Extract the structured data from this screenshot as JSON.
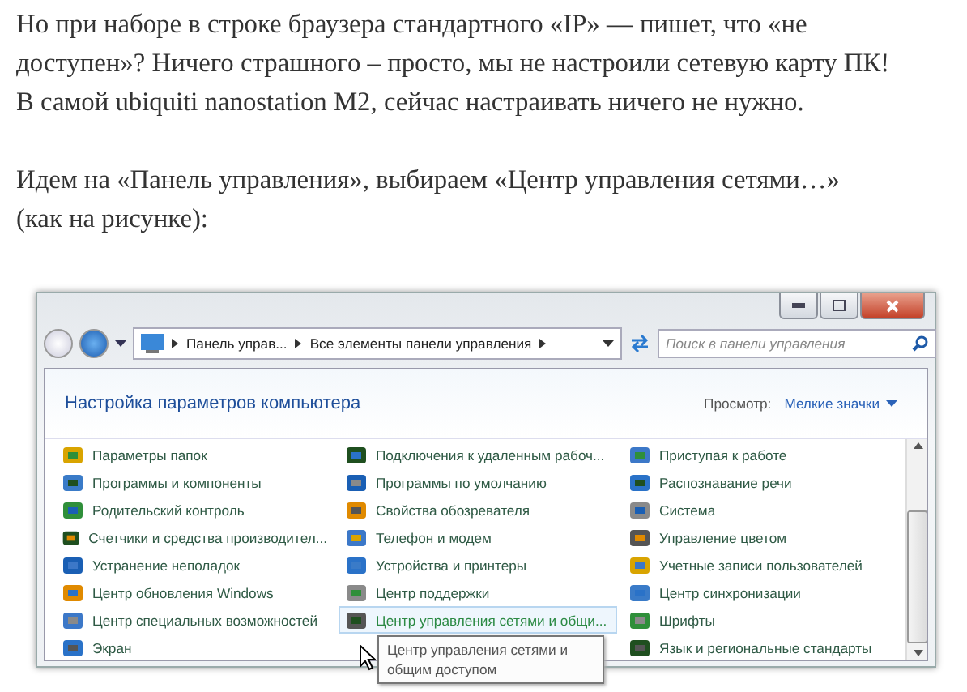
{
  "article": {
    "paragraphs": [
      {
        "lines": [
          "Но при наборе в строке браузера стандартного «IP» — пишет, что «не",
          "доступен»? Ничего страшного – просто, мы не настроили сетевую карту ПК!",
          "В самой ubiquiti nanostation M2, сейчас настраивать ничего не нужно."
        ]
      },
      {
        "lines": [
          "Идем на «Панель управления», выбираем «Центр управления сетями…»",
          "(как на рисунке):"
        ]
      }
    ]
  },
  "window": {
    "breadcrumbs": [
      "Панель управ...",
      "Все элементы панели управления"
    ],
    "search": {
      "placeholder": "Поиск в панели управления"
    },
    "heading": "Настройка параметров компьютера",
    "view_label": "Просмотр:",
    "view_value": "Мелкие значки",
    "columns": [
      [
        {
          "label": "Параметры папок",
          "selected": false
        },
        {
          "label": "Программы и компоненты",
          "selected": false
        },
        {
          "label": "Родительский контроль",
          "selected": false
        },
        {
          "label": "Счетчики и средства производител...",
          "selected": false
        },
        {
          "label": "Устранение неполадок",
          "selected": false
        },
        {
          "label": "Центр обновления Windows",
          "selected": false
        },
        {
          "label": "Центр специальных возможностей",
          "selected": false
        },
        {
          "label": "Экран",
          "selected": false
        }
      ],
      [
        {
          "label": "Подключения к удаленным рабоч...",
          "selected": false
        },
        {
          "label": "Программы по умолчанию",
          "selected": false
        },
        {
          "label": "Свойства обозревателя",
          "selected": false
        },
        {
          "label": "Телефон и модем",
          "selected": false
        },
        {
          "label": "Устройства и принтеры",
          "selected": false
        },
        {
          "label": "Центр поддержки",
          "selected": false
        },
        {
          "label": "Центр управления сетями и общи...",
          "selected": true
        }
      ],
      [
        {
          "label": "Приступая к работе",
          "selected": false
        },
        {
          "label": "Распознавание речи",
          "selected": false
        },
        {
          "label": "Система",
          "selected": false
        },
        {
          "label": "Управление цветом",
          "selected": false
        },
        {
          "label": "Учетные записи пользователей",
          "selected": false
        },
        {
          "label": "Центр синхронизации",
          "selected": false
        },
        {
          "label": "Шрифты",
          "selected": false
        },
        {
          "label": "Язык и региональные стандарты",
          "selected": false
        }
      ]
    ],
    "tooltip": "Центр управления сетями и общим доступом"
  }
}
